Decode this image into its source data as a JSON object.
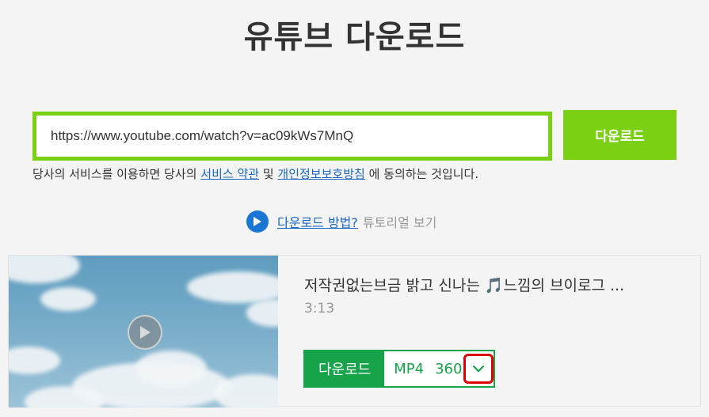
{
  "header": {
    "title": "유튜브 다운로드"
  },
  "search": {
    "value": "https://www.youtube.com/watch?v=ac09kWs7MnQ",
    "button_label": "다운로드"
  },
  "terms": {
    "prefix": "당사의 서비스를 이용하면 당사의 ",
    "terms_link": "서비스 약관",
    "middle": " 및 ",
    "privacy_link": "개인정보보호방침",
    "suffix": " 에 동의하는 것입니다."
  },
  "howto": {
    "link_label": "다운로드 방법?",
    "tutorial_label": "튜토리얼 보기"
  },
  "result": {
    "title": "저작권없는브금 밝고 신나는 🎵느낌의 브이로그 ...",
    "duration": "3:13",
    "download_label": "다운로드",
    "format": "MP4",
    "quality": "360"
  },
  "colors": {
    "accent_green": "#7bd014",
    "download_green": "#16a34a",
    "link_blue": "#1a66c2",
    "highlight_red": "#e00000"
  },
  "icons": {
    "howto": "play-circle-icon",
    "thumbnail": "play-icon",
    "dropdown": "chevron-down-icon"
  }
}
